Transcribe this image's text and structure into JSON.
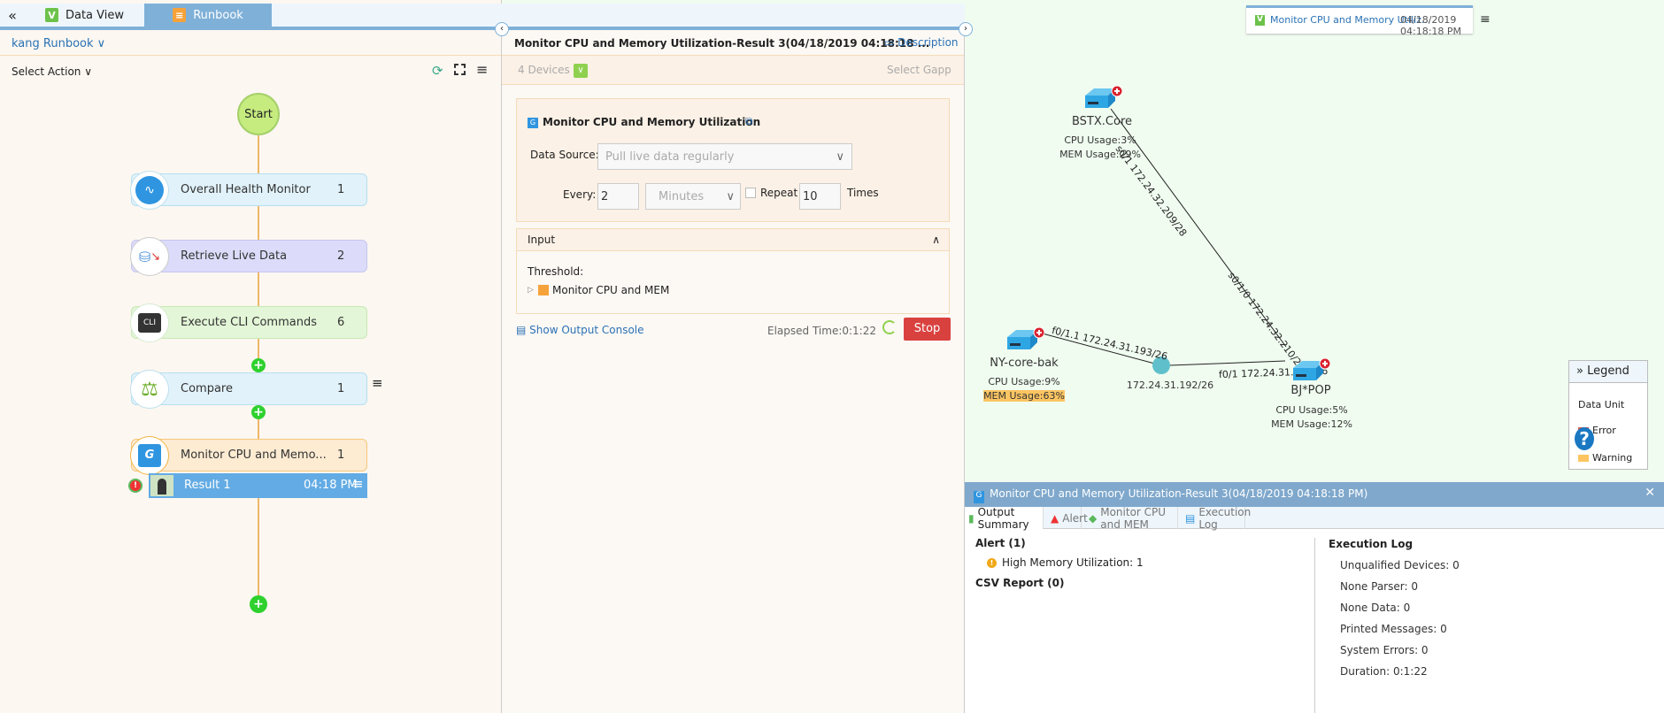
{
  "tabs": {
    "collapse": "«",
    "data_view": "Data View",
    "runbook": "Runbook"
  },
  "left": {
    "runbook_name": "kang Runbook",
    "select_action": "Select Action",
    "start": "Start",
    "nodes": [
      {
        "label": "Overall Health Monitor",
        "count": "1"
      },
      {
        "label": "Retrieve Live Data",
        "count": "2"
      },
      {
        "label": "Execute CLI Commands",
        "count": "6"
      },
      {
        "label": "Compare",
        "count": "1"
      },
      {
        "label": "Monitor CPU and Memo...",
        "count": "1"
      }
    ],
    "cli_icon": "CLI",
    "gapp_icon": "G",
    "result": {
      "label": "Result 1",
      "time": "04:18 PM"
    }
  },
  "mid": {
    "title": "Monitor CPU and Memory Utilization-Result 3(04/18/2019 04:18:18 ...",
    "description": "Description",
    "devices": "4 Devices",
    "select_gapp": "Select Gapp",
    "section_title": "Monitor CPU and Memory Utilization",
    "data_source_label": "Data Source:",
    "data_source_value": "Pull live data regularly",
    "every_label": "Every:",
    "every_value": "2",
    "unit": "Minutes",
    "repeat_label": "Repeat",
    "repeat_value": "10",
    "times_label": "Times",
    "input_header": "Input",
    "threshold_label": "Threshold:",
    "threshold_item": "Monitor CPU and MEM",
    "show_console": "Show Output Console",
    "elapsed": "Elapsed Time:0:1:22",
    "stop": "Stop"
  },
  "map": {
    "card_title": "Monitor CPU and Memory Utiliz...",
    "card_time": "04/18/2019 04:18:18 PM",
    "devices": [
      {
        "name": "BSTX.Core",
        "cpu": "CPU Usage:3%",
        "mem": "MEM Usage:29%"
      },
      {
        "name": "NY-core-bak",
        "cpu": "CPU Usage:9%",
        "mem": "MEM Usage:63%"
      },
      {
        "name": "BJ*POP",
        "cpu": "CPU Usage:5%",
        "mem": "MEM Usage:12%"
      }
    ],
    "hub": "172.24.31.192/26",
    "links": [
      "s0/1 172.24.32.209/28",
      "s0/1/0 172.24.32.210/28",
      "f0/1.1 172.24.31.193/26",
      "f0/1 172.24.31.195/26"
    ],
    "legend": {
      "title": "Legend",
      "data_unit": "Data Unit",
      "error": "Error",
      "warning": "Warning"
    },
    "help": "?"
  },
  "result_panel": {
    "title": "Monitor CPU and Memory Utilization-Result 3(04/18/2019 04:18:18 PM)",
    "tabs": [
      "Output Summary",
      "Alert",
      "Monitor CPU and MEM",
      "Execution Log"
    ],
    "alert_header": "Alert (1)",
    "alert_item": "High Memory Utilization: 1",
    "csv": "CSV Report (0)",
    "log_header": "Execution Log",
    "log": [
      "Unqualified Devices: 0",
      "None Parser: 0",
      "None Data: 0",
      "Printed Messages: 0",
      "System Errors: 0",
      "Duration: 0:1:22"
    ]
  },
  "colors": {
    "accent": "#7fb0d8",
    "stop": "#d9413f",
    "warning": "#fcc562",
    "error": "#e2574c"
  }
}
